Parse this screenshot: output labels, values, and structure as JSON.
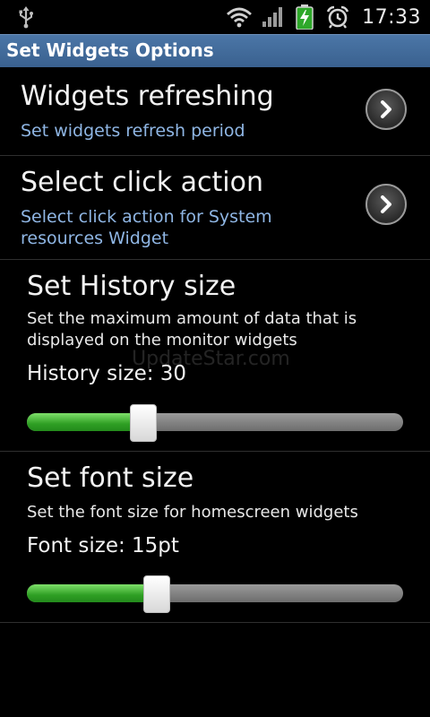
{
  "status_bar": {
    "time": "17:33",
    "icons": [
      "usb-icon",
      "wifi-icon",
      "signal-icon",
      "battery-charging-icon",
      "alarm-icon"
    ]
  },
  "header": {
    "title": "Set Widgets Options"
  },
  "preferences": {
    "refresh": {
      "title": "Widgets refreshing",
      "summary": "Set widgets refresh period"
    },
    "click_action": {
      "title": "Select click action",
      "summary": "Select click action for System resources Widget"
    },
    "history": {
      "title": "Set History size",
      "summary": "Set the maximum amount of data that is displayed on the monitor widgets",
      "value_label": "History size:  30",
      "slider_fraction": 0.31
    },
    "font": {
      "title": "Set font size",
      "summary": "Set the font size for homescreen widgets",
      "value_label": "Font size:  15pt",
      "slider_fraction": 0.345
    }
  },
  "watermark": "UpdateStar.com",
  "colors": {
    "accent_green": "#2f9f24",
    "title_bar_blue": "#4b76a7",
    "summary_blue": "#8fb6e4"
  }
}
